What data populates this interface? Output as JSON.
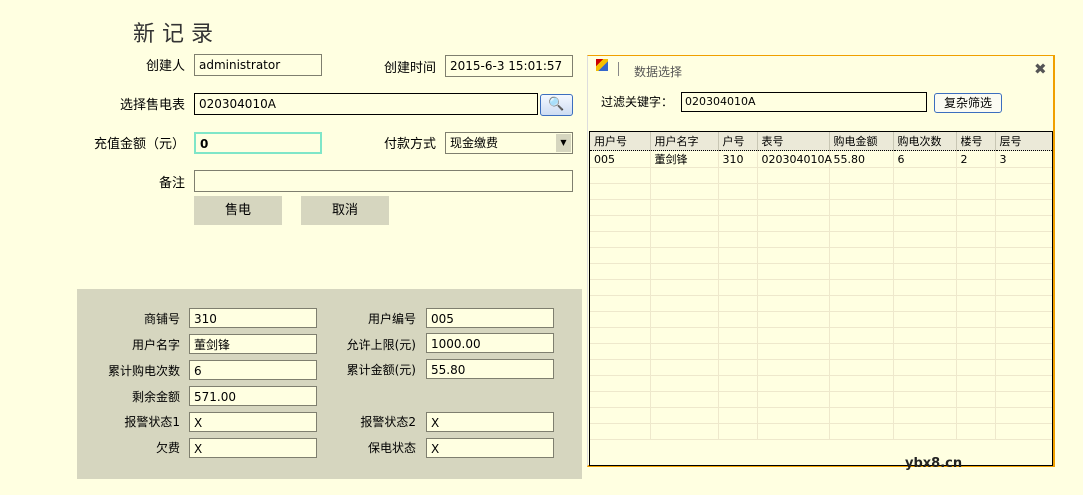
{
  "title": "新 记 录",
  "form": {
    "creator_label": "创建人",
    "creator": "administrator",
    "created_label": "创建时间",
    "created": "2015-6-3 15:01:57",
    "meter_label": "选择售电表",
    "meter": "020304010A",
    "amount_label": "充值金额（元）",
    "amount": "0",
    "pay_label": "付款方式",
    "pay": "现金缴费",
    "note_label": "备注",
    "note": "",
    "sell_btn": "售电",
    "cancel_btn": "取消"
  },
  "info": {
    "shop_label": "商铺号",
    "shop": "310",
    "userid_label": "用户编号",
    "userid": "005",
    "username_label": "用户名字",
    "username": "董剑锋",
    "limit_label": "允许上限(元)",
    "limit": "1000.00",
    "count_label": "累计购电次数",
    "count": "6",
    "total_label": "累计金额(元)",
    "total": "55.80",
    "remain_label": "剩余金额",
    "remain": "571.00",
    "alarm1_label": "报警状态1",
    "alarm1": "X",
    "alarm2_label": "报警状态2",
    "alarm2": "X",
    "owe_label": "欠费",
    "owe": "X",
    "protect_label": "保电状态",
    "protect": "X"
  },
  "popup": {
    "title": "数据选择",
    "filter_label": "过滤关键字：",
    "filter": "020304010A",
    "adv_btn": "复杂筛选",
    "columns": [
      "用户号",
      "用户名字",
      "户号",
      "表号",
      "购电金额",
      "购电次数",
      "楼号",
      "层号"
    ],
    "rows": [
      [
        "005",
        "董剑锋",
        "310",
        "020304010A",
        "55.80",
        "6",
        "2",
        "3"
      ]
    ]
  },
  "watermark": "ybx8.cn"
}
